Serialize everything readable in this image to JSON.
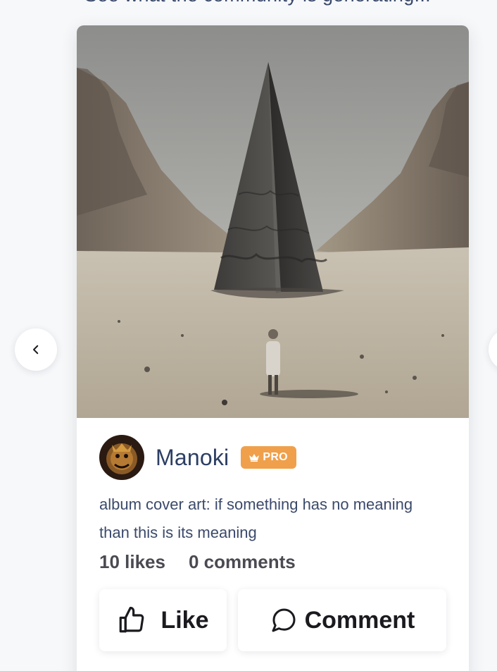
{
  "section": {
    "subtitle": "See what the community is generating..."
  },
  "post": {
    "image_subject": "monolith-pyramid-desert-canyon",
    "user": {
      "name": "Manoki",
      "badge": "PRO",
      "avatar_subject": "golden-demon-mask"
    },
    "description": "album cover art: if something has no meaning than this is its meaning",
    "likes_label": "10 likes",
    "comments_label": "0 comments",
    "like_button_label": "Like",
    "comment_button_label": "Comment"
  },
  "icons": {
    "prev": "chevron-left-icon",
    "like": "thumbs-up-icon",
    "comment": "speech-bubble-icon",
    "crown": "crown-icon"
  },
  "colors": {
    "badge_bg": "#f0a04b",
    "username": "#2c3e63",
    "description": "#3b4a6b",
    "stats": "#4a4a52"
  }
}
